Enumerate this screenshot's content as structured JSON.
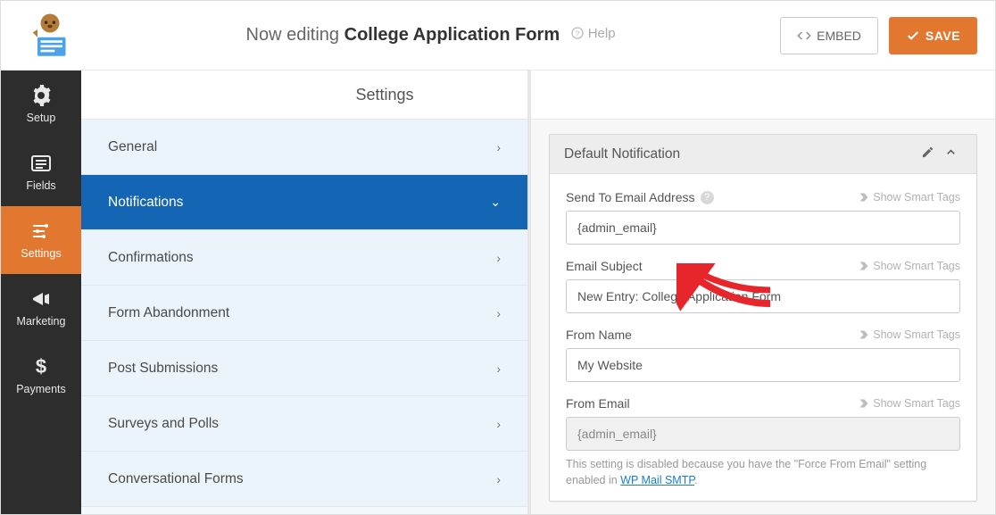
{
  "header": {
    "prefix": "Now editing",
    "form_name": "College Application Form",
    "help": "Help",
    "embed": "EMBED",
    "save": "SAVE"
  },
  "iconbar": [
    {
      "label": "Setup",
      "active": false
    },
    {
      "label": "Fields",
      "active": false
    },
    {
      "label": "Settings",
      "active": true
    },
    {
      "label": "Marketing",
      "active": false
    },
    {
      "label": "Payments",
      "active": false
    }
  ],
  "mid": {
    "heading": "Settings",
    "items": [
      {
        "label": "General",
        "expanded": false
      },
      {
        "label": "Notifications",
        "expanded": true,
        "active": true
      },
      {
        "label": "Confirmations",
        "expanded": false
      },
      {
        "label": "Form Abandonment",
        "expanded": false
      },
      {
        "label": "Post Submissions",
        "expanded": false
      },
      {
        "label": "Surveys and Polls",
        "expanded": false
      },
      {
        "label": "Conversational Forms",
        "expanded": false
      }
    ]
  },
  "panel": {
    "title": "Default Notification",
    "smart_tags": "Show Smart Tags",
    "fields": {
      "send_to": {
        "label": "Send To Email Address",
        "value": "{admin_email}",
        "has_help": true
      },
      "subject": {
        "label": "Email Subject",
        "value": "New Entry: College Application Form"
      },
      "from_name": {
        "label": "From Name",
        "value": "My Website"
      },
      "from_email": {
        "label": "From Email",
        "value": "{admin_email}",
        "disabled": true,
        "note_pre": "This setting is disabled because you have the \"Force From Email\" setting enabled in ",
        "note_link": "WP Mail SMTP",
        "note_post": "."
      }
    }
  }
}
